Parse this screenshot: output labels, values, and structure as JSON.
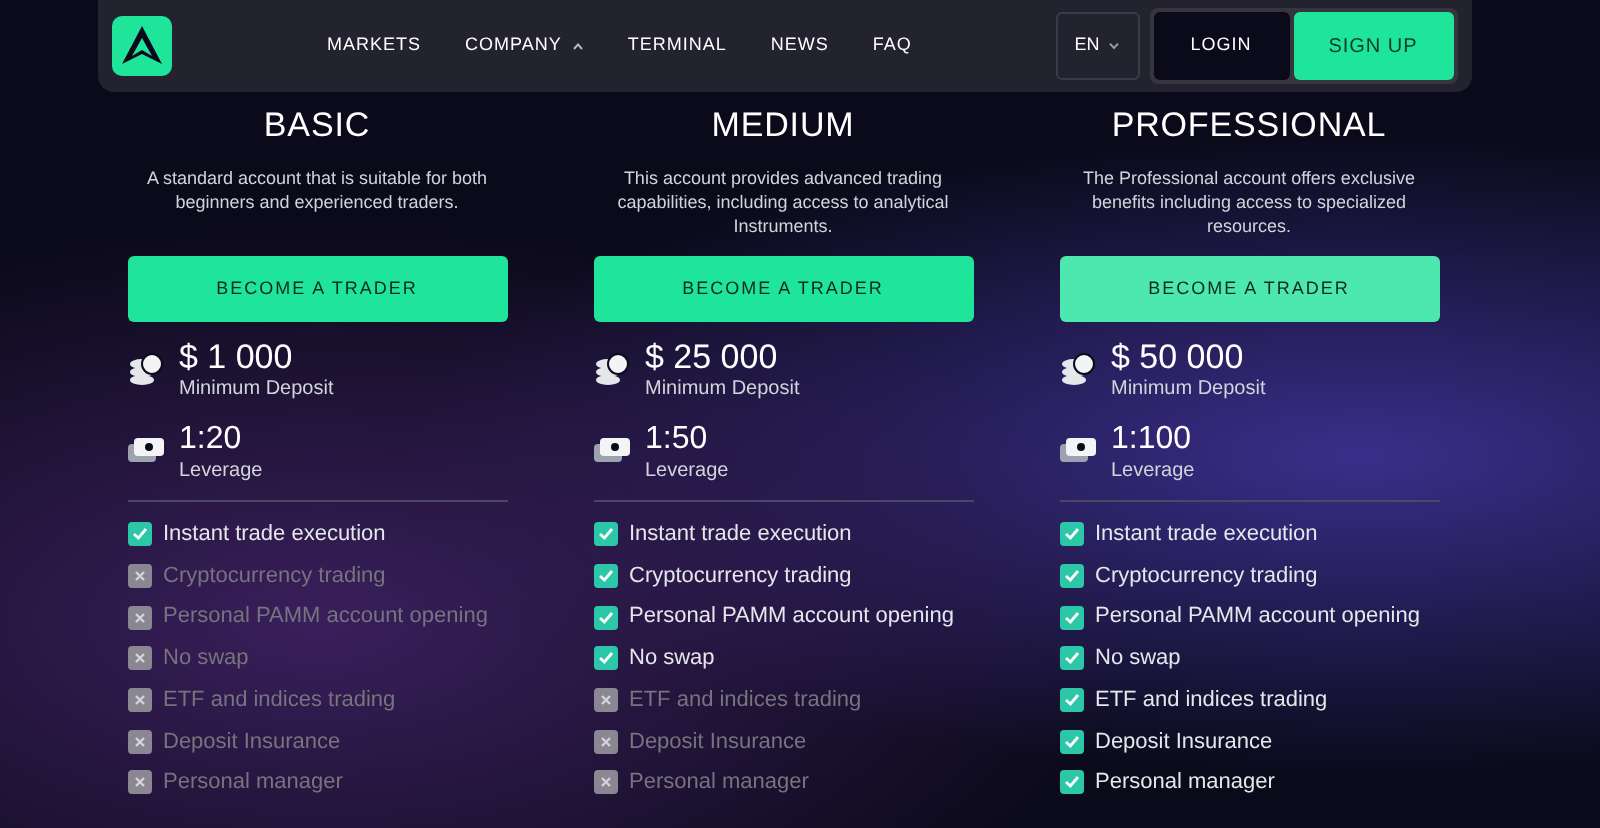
{
  "nav": {
    "links": [
      {
        "label": "MARKETS",
        "dropdown": false
      },
      {
        "label": "COMPANY",
        "dropdown": true
      },
      {
        "label": "TERMINAL",
        "dropdown": false
      },
      {
        "label": "NEWS",
        "dropdown": false
      },
      {
        "label": "FAQ",
        "dropdown": false
      }
    ],
    "language": "EN",
    "login": "LOGIN",
    "signup": "SIGN UP"
  },
  "plans": [
    {
      "title": "BASIC",
      "description": "A standard account that is suitable for both beginners and experienced traders.",
      "button": "BECOME A TRADER",
      "deposit": "$ 1 000",
      "deposit_label": "Minimum Deposit",
      "leverage": "1:20",
      "leverage_label": "Leverage",
      "features": [
        {
          "label": "Instant trade execution",
          "checked": true
        },
        {
          "label": "Cryptocurrency trading",
          "checked": false
        },
        {
          "label": "Personal PAMM account opening",
          "checked": false
        },
        {
          "label": "No swap",
          "checked": false
        },
        {
          "label": "ETF and indices trading",
          "checked": false
        },
        {
          "label": "Deposit Insurance",
          "checked": false
        },
        {
          "label": "Personal manager",
          "checked": false
        }
      ]
    },
    {
      "title": "MEDIUM",
      "description": "This account provides advanced trading capabilities, including access to analytical Instruments.",
      "button": "BECOME A TRADER",
      "deposit": "$ 25 000",
      "deposit_label": "Minimum Deposit",
      "leverage": "1:50",
      "leverage_label": "Leverage",
      "features": [
        {
          "label": "Instant trade execution",
          "checked": true
        },
        {
          "label": "Cryptocurrency trading",
          "checked": true
        },
        {
          "label": "Personal PAMM account opening",
          "checked": true
        },
        {
          "label": "No swap",
          "checked": true
        },
        {
          "label": "ETF and indices trading",
          "checked": false
        },
        {
          "label": "Deposit Insurance",
          "checked": false
        },
        {
          "label": "Personal manager",
          "checked": false
        }
      ]
    },
    {
      "title": "PROFESSIONAL",
      "description": "The Professional account offers exclusive benefits including access to specialized resources.",
      "button": "BECOME A TRADER",
      "deposit": "$ 50 000",
      "deposit_label": "Minimum Deposit",
      "leverage": "1:100",
      "leverage_label": "Leverage",
      "features": [
        {
          "label": "Instant trade execution",
          "checked": true
        },
        {
          "label": "Cryptocurrency trading",
          "checked": true
        },
        {
          "label": "Personal PAMM account opening",
          "checked": true
        },
        {
          "label": "No swap",
          "checked": true
        },
        {
          "label": "ETF and indices trading",
          "checked": true
        },
        {
          "label": "Deposit Insurance",
          "checked": true
        },
        {
          "label": "Personal manager",
          "checked": true
        }
      ]
    }
  ]
}
